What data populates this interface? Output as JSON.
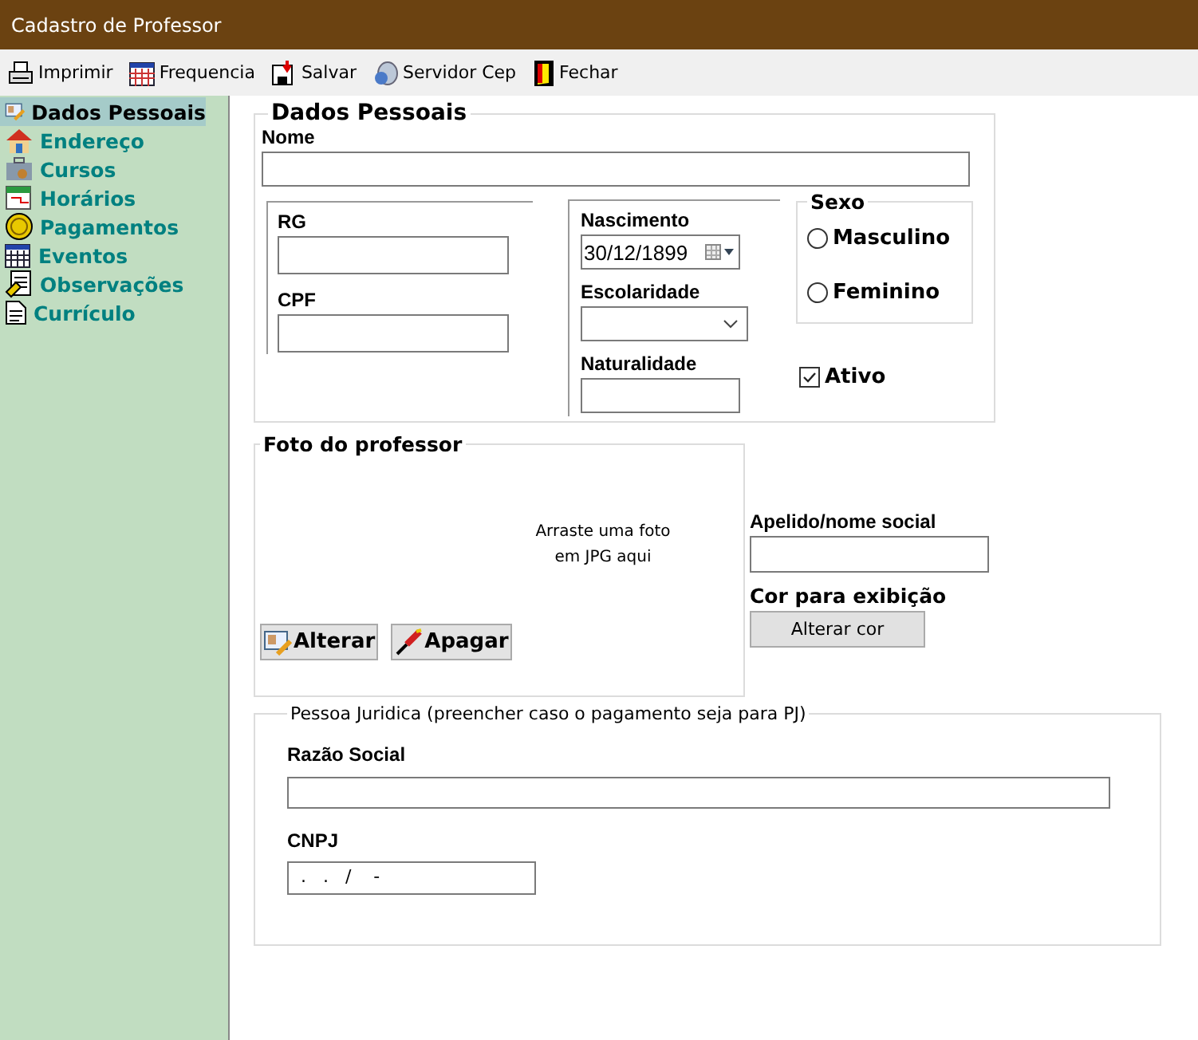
{
  "window": {
    "title": "Cadastro de Professor"
  },
  "toolbar": [
    {
      "label": "Imprimir",
      "kind": "printer"
    },
    {
      "label": "Frequencia",
      "kind": "calendar"
    },
    {
      "label": "Salvar",
      "kind": "save"
    },
    {
      "label": "Servidor Cep",
      "kind": "server"
    },
    {
      "label": "Fechar",
      "kind": "door"
    }
  ],
  "sidebar": {
    "items": [
      {
        "label": "Dados Pessoais",
        "kind": "card",
        "selected": true
      },
      {
        "label": "Endereço",
        "kind": "house",
        "selected": false
      },
      {
        "label": "Cursos",
        "kind": "case",
        "selected": false
      },
      {
        "label": "Horários",
        "kind": "schedule",
        "selected": false
      },
      {
        "label": "Pagamentos",
        "kind": "coin",
        "selected": false
      },
      {
        "label": "Eventos",
        "kind": "calendar",
        "selected": false
      },
      {
        "label": "Observações",
        "kind": "notes",
        "selected": false
      },
      {
        "label": "Currículo",
        "kind": "doc",
        "selected": false
      }
    ]
  },
  "dados_pessoais": {
    "title": "Dados Pessoais",
    "nome": {
      "label": "Nome"
    },
    "rg": {
      "label": "RG"
    },
    "cpf": {
      "label": "CPF"
    },
    "nascimento": {
      "label": "Nascimento",
      "value": "30/12/1899"
    },
    "escolaridade": {
      "label": "Escolaridade"
    },
    "naturalidade": {
      "label": "Naturalidade"
    },
    "sexo": {
      "title": "Sexo",
      "options": [
        {
          "label": "Masculino",
          "selected": false
        },
        {
          "label": "Feminino",
          "selected": false
        }
      ]
    },
    "ativo": {
      "label": "Ativo",
      "checked": true
    }
  },
  "foto": {
    "title": "Foto do professor",
    "hint": [
      "Arraste uma foto",
      "em JPG aqui"
    ],
    "buttons": [
      {
        "label": "Alterar",
        "kind": "edit"
      },
      {
        "label": "Apagar",
        "kind": "erase"
      }
    ]
  },
  "apelido": {
    "label": "Apelido/nome social"
  },
  "cor": {
    "label": "Cor para exibição",
    "button": "Alterar cor"
  },
  "pessoa_juridica": {
    "title": "Pessoa Juridica (preencher caso o pagamento seja para PJ)",
    "razao_social": {
      "label": "Razão Social"
    },
    "cnpj": {
      "label": "CNPJ",
      "value": " .   .   /    -"
    }
  }
}
